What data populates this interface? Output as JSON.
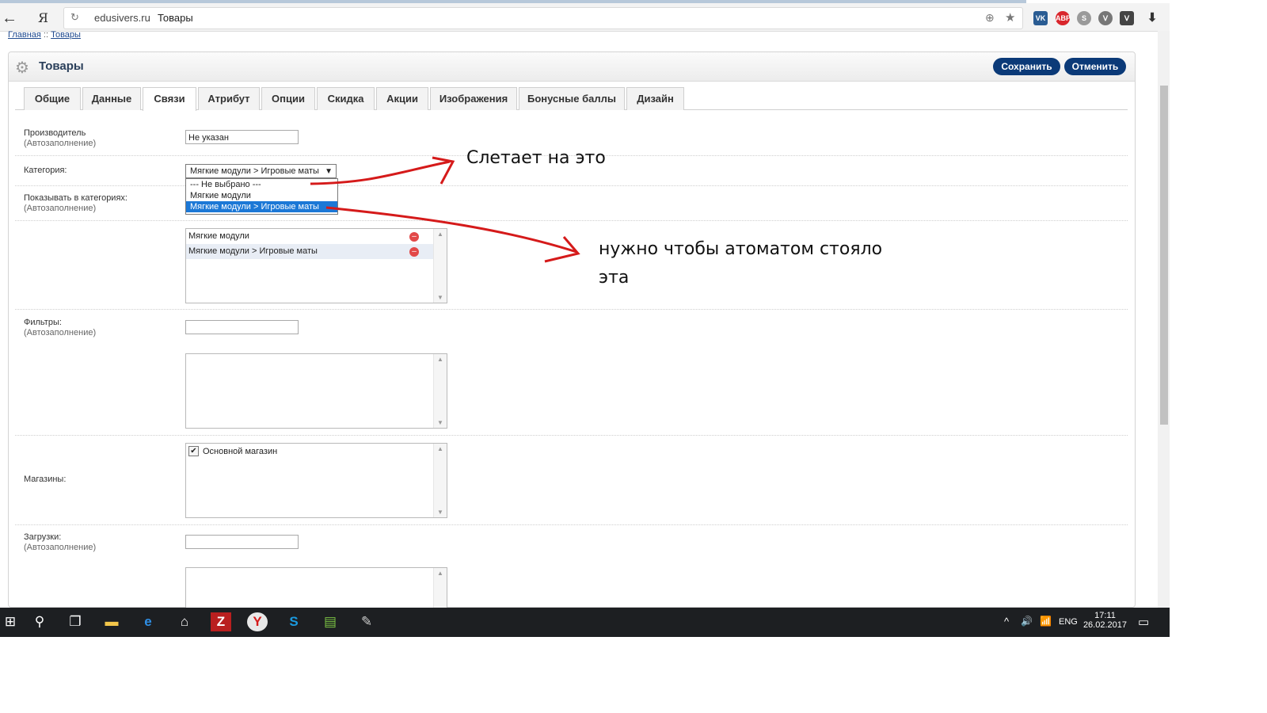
{
  "browser": {
    "back": "←",
    "yandex": "Я",
    "reload": "↻",
    "domain": "edusivers.ru",
    "page_title": "Товары",
    "extensions": [
      "⊕",
      "★"
    ],
    "ext_badges": [
      "VK",
      "ABP",
      "S",
      "ᐯ",
      "⬇"
    ]
  },
  "breadcrumb": {
    "home": "Главная",
    "sep": " :: ",
    "current": "Товары"
  },
  "header": {
    "title": "Товары",
    "save": "Сохранить",
    "cancel": "Отменить"
  },
  "tabs": [
    "Общие",
    "Данные",
    "Связи",
    "Атрибут",
    "Опции",
    "Скидка",
    "Акции",
    "Изображения",
    "Бонусные баллы",
    "Дизайн"
  ],
  "form": {
    "manufacturer": {
      "label": "Производитель",
      "hint": "(Автозаполнение)",
      "value": "Не указан"
    },
    "category": {
      "label": "Категория:",
      "selected": "Мягкие модули > Игровые маты",
      "options": [
        "--- Не выбрано ---",
        "Мягкие модули",
        "Мягкие модули > Игровые маты"
      ]
    },
    "show_in": {
      "label": "Показывать в категориях:",
      "hint": "(Автозаполнение)",
      "items": [
        "Мягкие модули",
        "Мягкие модули > Игровые маты"
      ]
    },
    "filters": {
      "label": "Фильтры:",
      "hint": "(Автозаполнение)"
    },
    "stores": {
      "label": "Магазины:",
      "items": [
        "Основной магазин"
      ]
    },
    "downloads": {
      "label": "Загрузки:",
      "hint": "(Автозаполнение)"
    }
  },
  "annotations": {
    "note1": "Слетает на это",
    "note2": "нужно чтобы атоматом стояло",
    "note3": "эта",
    "arrow_color": "#d51a1a"
  },
  "taskbar": {
    "lang": "ENG",
    "time": "17:11",
    "date": "26.02.2017",
    "tray": [
      "^",
      "🔊",
      "📶"
    ]
  }
}
